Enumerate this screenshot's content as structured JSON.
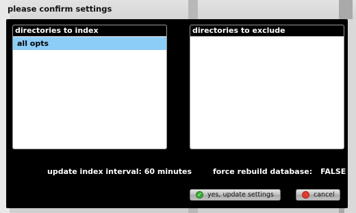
{
  "dialog": {
    "title": "please confirm settings"
  },
  "panels": {
    "index": {
      "header": "directories to index",
      "items": [
        "all  opts"
      ]
    },
    "exclude": {
      "header": "directories to exclude",
      "items": []
    }
  },
  "settings": {
    "interval_label": "update index interval: 60 minutes",
    "rebuild_label": "force rebuild database:",
    "rebuild_value": "FALSE"
  },
  "buttons": {
    "ok_label": "yes, update settings",
    "ok_icon": "check-icon",
    "cancel_label": "cancel",
    "cancel_icon": "cancel-icon"
  },
  "colors": {
    "selection": "#8ccdf7",
    "ok_icon": "#3aaa35",
    "cancel_icon": "#e03a2f"
  }
}
